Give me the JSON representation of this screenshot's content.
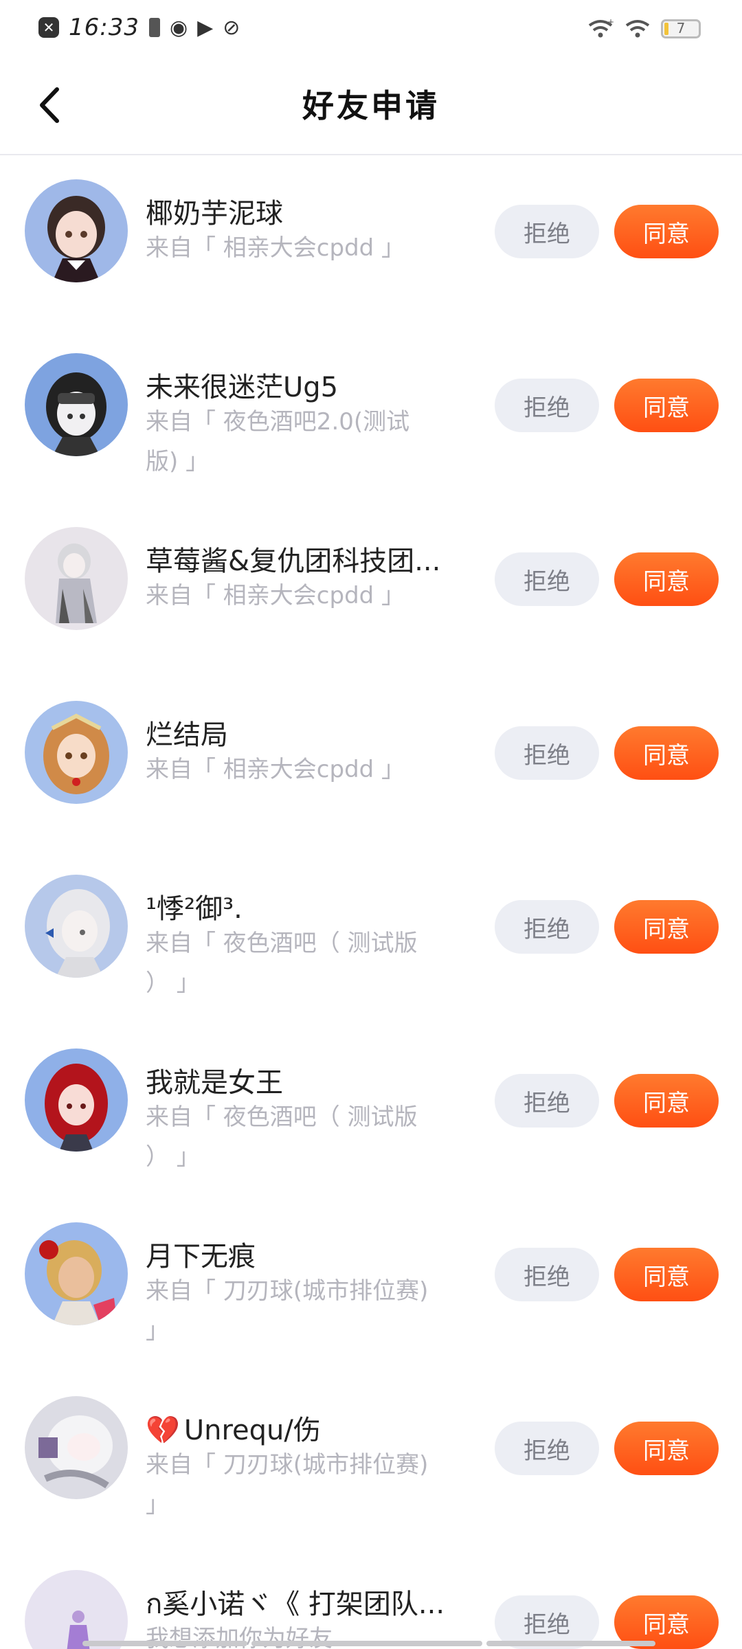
{
  "status_bar": {
    "time": "16:33",
    "battery_level": "7",
    "icons": [
      "notification-x-icon",
      "battery-saver-icon",
      "wechat-icon",
      "play-icon",
      "leaf-icon",
      "wifi-plus-icon",
      "wifi-icon",
      "battery-icon"
    ]
  },
  "header": {
    "title": "好友申请",
    "back_icon": "chevron-left-icon"
  },
  "buttons": {
    "reject": "拒绝",
    "accept": "同意"
  },
  "requests": [
    {
      "name": "椰奶芋泥球",
      "source": "来自「 相亲大会cpdd 」"
    },
    {
      "name": "未来很迷茫Ug5",
      "source": "来自「 夜色酒吧2.0(测试版) 」"
    },
    {
      "name": "草莓酱&复仇团科技团...",
      "source": "来自「 相亲大会cpdd 」"
    },
    {
      "name": "烂结局",
      "source": "来自「 相亲大会cpdd 」"
    },
    {
      "name": "¹悸²御³.",
      "source": "来自「 夜色酒吧（ 测试版 ） 」"
    },
    {
      "name": "我就是女王",
      "source": "来自「 夜色酒吧（ 测试版 ） 」"
    },
    {
      "name": "月下无痕",
      "source": "来自「 刀刃球(城市排位赛) 」"
    },
    {
      "name": "Unrequ/伤",
      "source": "来自「 刀刃球(城市排位赛) 」"
    },
    {
      "name": "ก奚小诺ヾ《 打架团队...",
      "source": "我想添加你为好友"
    }
  ],
  "colors": {
    "accept_bg": "#ff5a1d",
    "reject_bg": "#eceef4",
    "secondary_text": "#b5b5bd"
  }
}
